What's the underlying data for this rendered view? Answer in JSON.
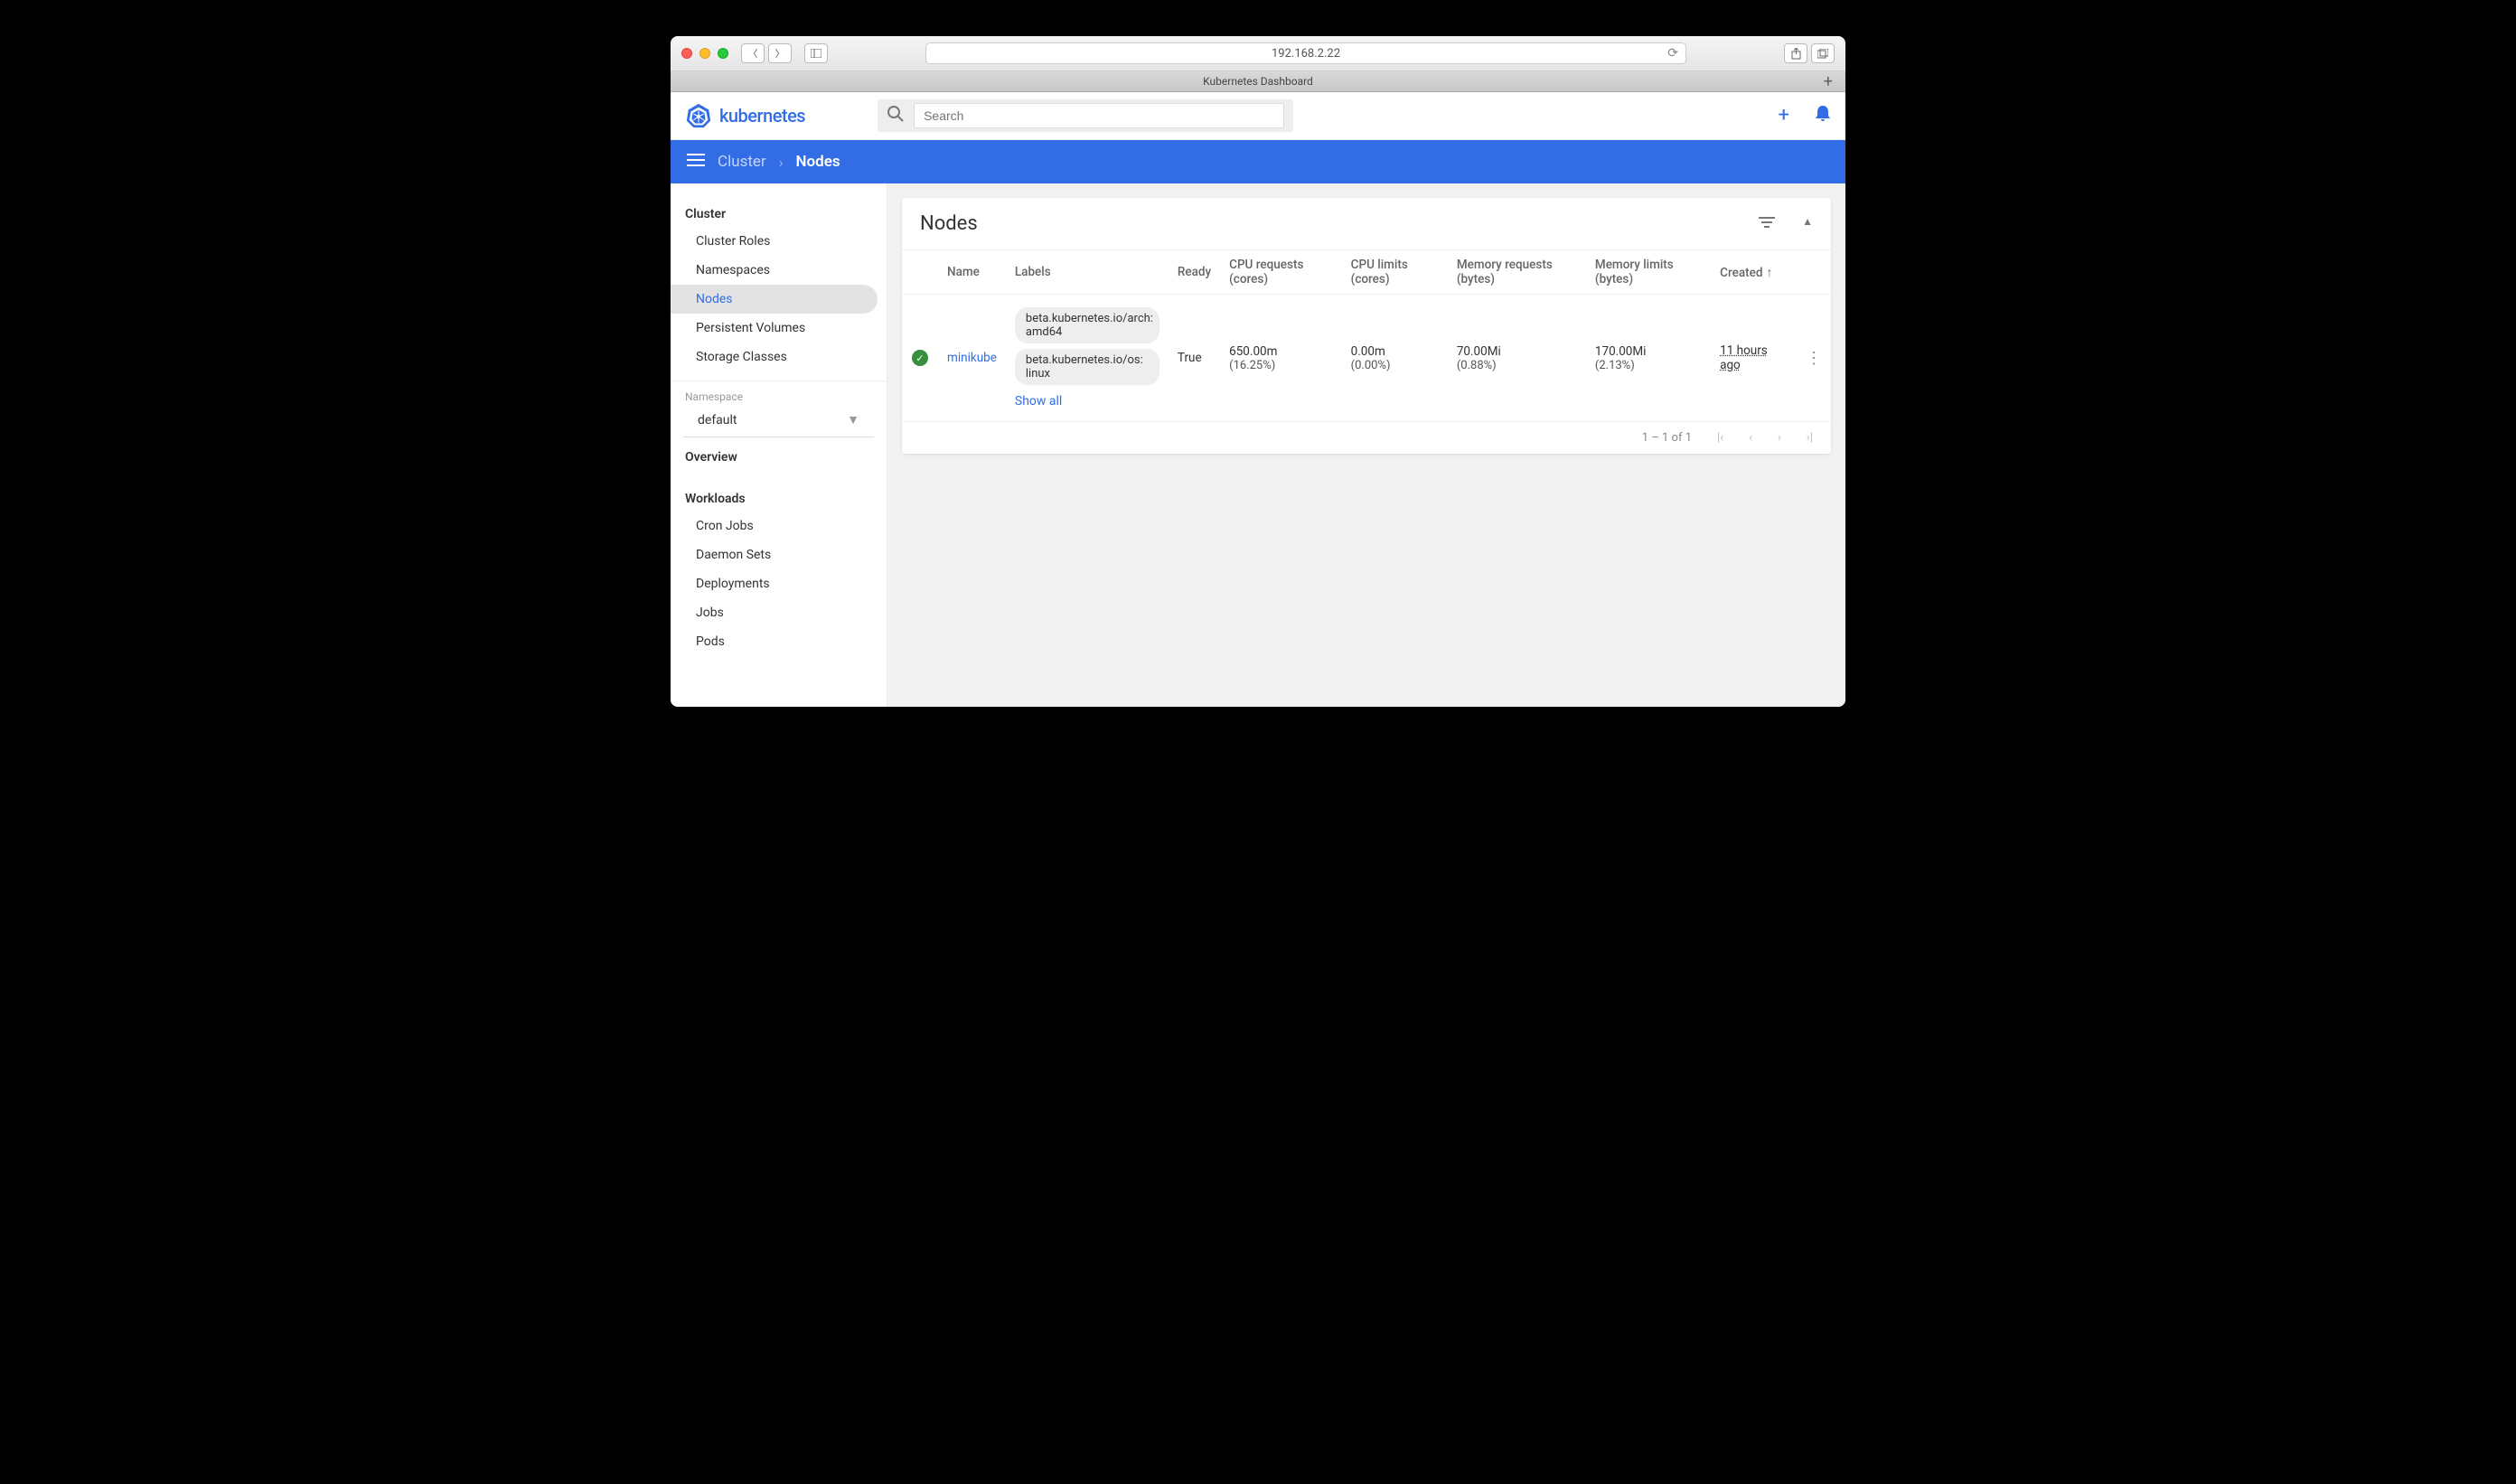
{
  "browser": {
    "url": "192.168.2.22",
    "tab_title": "Kubernetes Dashboard"
  },
  "header": {
    "logo_text": "kubernetes",
    "search_placeholder": "Search"
  },
  "breadcrumb": {
    "parent": "Cluster",
    "current": "Nodes"
  },
  "sidebar": {
    "cluster_heading": "Cluster",
    "cluster_items": [
      "Cluster Roles",
      "Namespaces",
      "Nodes",
      "Persistent Volumes",
      "Storage Classes"
    ],
    "namespace_label": "Namespace",
    "namespace_selected": "default",
    "overview_heading": "Overview",
    "workloads_heading": "Workloads",
    "workloads_items": [
      "Cron Jobs",
      "Daemon Sets",
      "Deployments",
      "Jobs",
      "Pods"
    ]
  },
  "card": {
    "title": "Nodes",
    "columns": {
      "name": "Name",
      "labels": "Labels",
      "ready": "Ready",
      "cpu_req": "CPU requests (cores)",
      "cpu_lim": "CPU limits (cores)",
      "mem_req": "Memory requests (bytes)",
      "mem_lim": "Memory limits (bytes)",
      "created": "Created"
    },
    "row": {
      "name": "minikube",
      "labels": [
        "beta.kubernetes.io/arch: amd64",
        "beta.kubernetes.io/os: linux"
      ],
      "show_all": "Show all",
      "ready": "True",
      "cpu_req": "650.00m",
      "cpu_req_pct": "(16.25%)",
      "cpu_lim": "0.00m",
      "cpu_lim_pct": "(0.00%)",
      "mem_req": "70.00Mi",
      "mem_req_pct": "(0.88%)",
      "mem_lim": "170.00Mi",
      "mem_lim_pct": "(2.13%)",
      "created": "11 hours ago"
    },
    "pagination": "1 – 1 of 1"
  }
}
